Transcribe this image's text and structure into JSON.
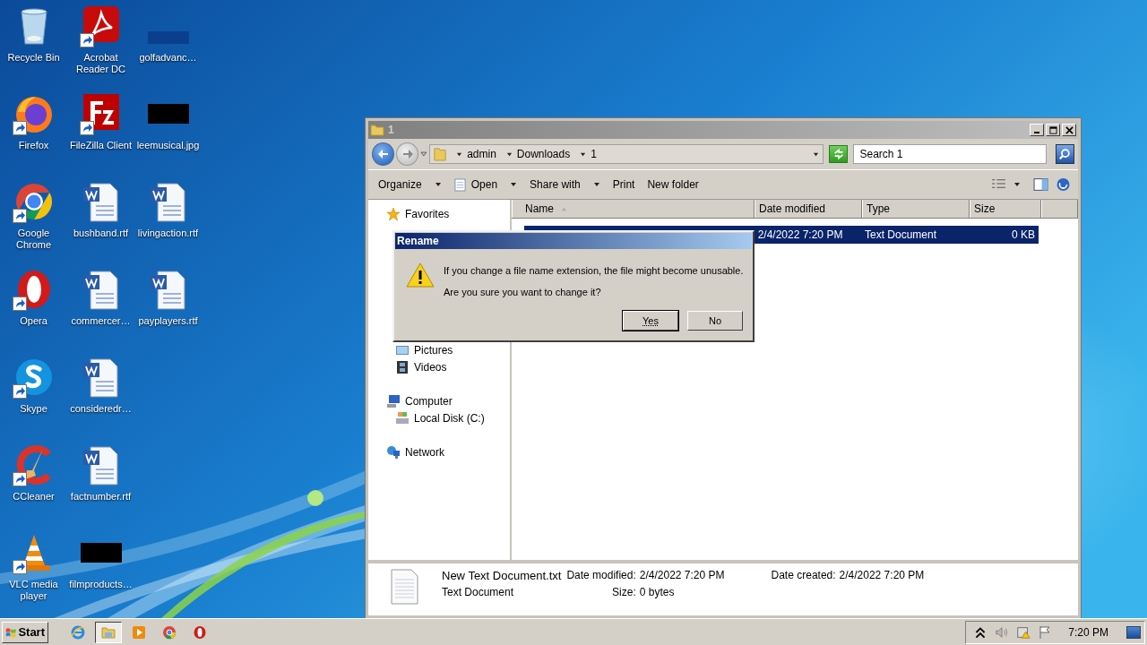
{
  "desktop": {
    "columns": [
      [
        {
          "label": "Recycle Bin",
          "kind": "recycle",
          "shortcut": false
        },
        {
          "label": "Firefox",
          "kind": "firefox",
          "shortcut": true
        },
        {
          "label": "Google Chrome",
          "kind": "chrome",
          "shortcut": true
        },
        {
          "label": "Opera",
          "kind": "opera",
          "shortcut": true
        },
        {
          "label": "Skype",
          "kind": "skype",
          "shortcut": true
        },
        {
          "label": "CCleaner",
          "kind": "ccleaner",
          "shortcut": true
        },
        {
          "label": "VLC media player",
          "kind": "vlc",
          "shortcut": true
        }
      ],
      [
        {
          "label": "Acrobat Reader DC",
          "kind": "acrobat",
          "shortcut": true
        },
        {
          "label": "FileZilla Client",
          "kind": "filezilla",
          "shortcut": true
        },
        {
          "label": "bushband.rtf",
          "kind": "word",
          "shortcut": false
        },
        {
          "label": "commercer…",
          "kind": "word",
          "shortcut": false
        },
        {
          "label": "consideredr…",
          "kind": "word",
          "shortcut": false
        },
        {
          "label": "factnumber.rtf",
          "kind": "word",
          "shortcut": false
        },
        {
          "label": "filmproducts…",
          "kind": "redacted",
          "shortcut": false
        }
      ],
      [
        {
          "label": "golfadvanc…",
          "kind": "blank",
          "shortcut": false
        },
        {
          "label": "leemusical.jpg",
          "kind": "redacted",
          "shortcut": false
        },
        {
          "label": "livingaction.rtf",
          "kind": "word",
          "shortcut": false
        },
        {
          "label": "payplayers.rtf",
          "kind": "word",
          "shortcut": false
        }
      ]
    ]
  },
  "explorer": {
    "title": "1",
    "crumbs": [
      "admin",
      "Downloads",
      "1"
    ],
    "search": {
      "placeholder": "Search 1"
    },
    "toolbar": [
      {
        "label": "Organize",
        "kind": "menu"
      },
      {
        "label": "Open",
        "kind": "split"
      },
      {
        "label": "Share with",
        "kind": "menu"
      },
      {
        "label": "Print",
        "kind": "command"
      },
      {
        "label": "New folder",
        "kind": "command"
      }
    ],
    "nav": [
      {
        "label": "Favorites",
        "kind": "favorites"
      },
      {
        "label": "Pictures",
        "kind": "pictures"
      },
      {
        "label": "Videos",
        "kind": "videos"
      },
      {
        "label": "Computer",
        "kind": "computer",
        "children": [
          {
            "label": "Local Disk (C:)",
            "kind": "disk"
          }
        ]
      },
      {
        "label": "Network",
        "kind": "network"
      }
    ],
    "columns": [
      {
        "label": "Name",
        "sorted": true
      },
      {
        "label": "Date modified",
        "sorted": false
      },
      {
        "label": "Type",
        "sorted": false
      },
      {
        "label": "Size",
        "sorted": false
      }
    ],
    "rows": [
      {
        "date": "2/4/2022 7:20 PM",
        "type": "Text Document",
        "size": "0 KB",
        "selected": true
      }
    ],
    "details": {
      "name": "New Text Document.txt",
      "type": "Text Document",
      "fields": [
        {
          "label": "Date modified:",
          "value": "2/4/2022 7:20 PM"
        },
        {
          "label": "Size:",
          "value": "0 bytes"
        },
        {
          "label": "Date created:",
          "value": "2/4/2022 7:20 PM"
        }
      ]
    }
  },
  "dialog": {
    "title": "Rename",
    "lines": [
      "If you change a file name extension, the file might become unusable.",
      "Are you sure you want to change it?"
    ],
    "buttons": [
      {
        "label": "Yes",
        "default": true
      },
      {
        "label": "No",
        "default": false
      }
    ]
  },
  "taskbar": {
    "start": "Start",
    "apps": [
      {
        "kind": "ie",
        "active": false
      },
      {
        "kind": "explorer",
        "active": true
      },
      {
        "kind": "media",
        "active": false
      },
      {
        "kind": "chrome",
        "active": false
      },
      {
        "kind": "opera",
        "active": false
      }
    ],
    "clock": "7:20 PM"
  }
}
